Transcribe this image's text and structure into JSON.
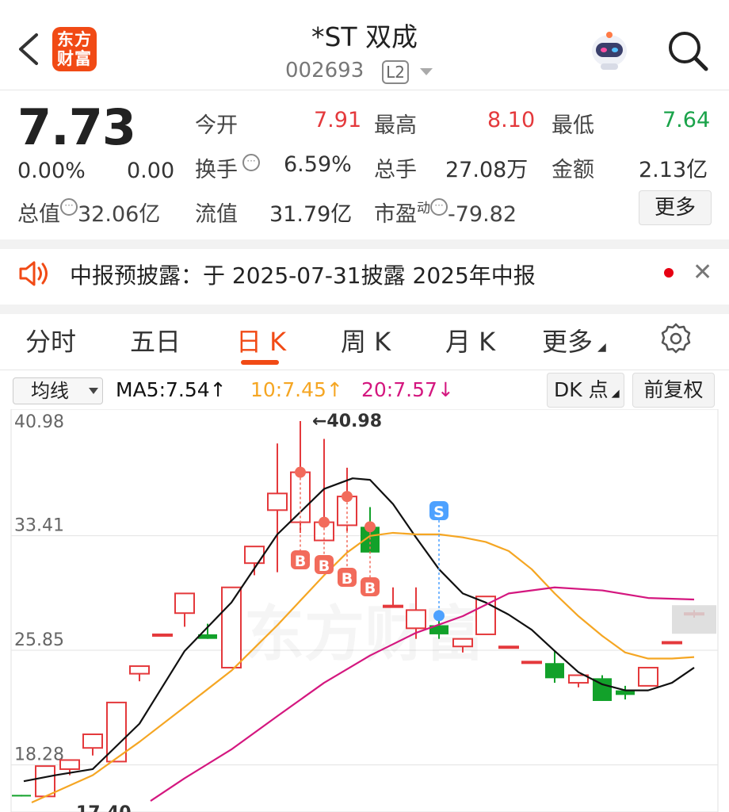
{
  "header": {
    "logo_text_line1": "东方",
    "logo_text_line2": "财富",
    "stock_name": "*ST 双成",
    "stock_code": "002693",
    "level_badge": "L2",
    "icons": [
      "back-chevron-icon",
      "robot-avatar-icon",
      "search-icon"
    ]
  },
  "quote": {
    "price": "7.73",
    "change_pct": "0.00%",
    "change": "0.00",
    "open_label": "今开",
    "open": "7.91",
    "high_label": "最高",
    "high": "8.10",
    "low_label": "最低",
    "low": "7.64",
    "turnover_label": "换手",
    "turnover": "6.59%",
    "volume_label": "总手",
    "volume": "27.08万",
    "amount_label": "金额",
    "amount": "2.13亿",
    "mktcap_label": "总值",
    "mktcap": "32.06亿",
    "float_label": "流值",
    "float_cap": "31.79亿",
    "pe_label": "市盈",
    "pe_sup": "动",
    "pe": "-79.82",
    "more_label": "更多"
  },
  "notice": {
    "text": "中报预披露：于 2025-07-31披露 2025年中报",
    "icons": [
      "speaker-icon",
      "close-icon"
    ]
  },
  "tabs": [
    {
      "label": "分时",
      "active": false
    },
    {
      "label": "五日",
      "active": false
    },
    {
      "label": "日 K",
      "active": true
    },
    {
      "label": "周 K",
      "active": false
    },
    {
      "label": "月 K",
      "active": false
    },
    {
      "label": "更多",
      "active": false
    }
  ],
  "chart_controls": {
    "indicator_select": "均线",
    "ma5": "MA5:7.54↑",
    "ma10": "10:7.45↑",
    "ma20": "20:7.57↓",
    "dk_button": "DK 点",
    "adjust_button": "前复权",
    "colors": {
      "ma5": "#111111",
      "ma10": "#f5a623",
      "ma20": "#d4177f"
    }
  },
  "chart_data": {
    "type": "candlestick",
    "y_axis_ticks": [
      "40.98",
      "33.41",
      "25.85",
      "18.28"
    ],
    "ylim": [
      16.0,
      42.0
    ],
    "high_marker": "←40.98",
    "low_label_partial": "17.40",
    "watermark": "东方财富",
    "colors": {
      "up": "#e4393c",
      "down": "#12a12a",
      "buy_marker": "#f26b5b",
      "sell_marker": "#4da1ff"
    },
    "candles": [
      {
        "x": 27,
        "o": 16.3,
        "c": 16.2,
        "h": 16.3,
        "l": 16.2
      },
      {
        "x": 57,
        "o": 16.2,
        "c": 18.2,
        "h": 18.2,
        "l": 16.2
      },
      {
        "x": 88,
        "o": 18.0,
        "c": 18.6,
        "h": 18.6,
        "l": 17.6
      },
      {
        "x": 117,
        "o": 19.4,
        "c": 20.3,
        "h": 20.3,
        "l": 18.9
      },
      {
        "x": 147,
        "o": 18.5,
        "c": 22.4,
        "h": 22.4,
        "l": 18.5
      },
      {
        "x": 176,
        "o": 24.3,
        "c": 24.8,
        "h": 24.8,
        "l": 23.8
      },
      {
        "x": 205,
        "o": 26.9,
        "c": 26.9,
        "h": 26.9,
        "l": 26.9
      },
      {
        "x": 233,
        "o": 28.3,
        "c": 29.6,
        "h": 29.6,
        "l": 27.4
      },
      {
        "x": 262,
        "o": 26.9,
        "c": 26.6,
        "h": 27.6,
        "l": 26.6
      },
      {
        "x": 292,
        "o": 24.7,
        "c": 30.0,
        "h": 30.0,
        "l": 24.7
      },
      {
        "x": 321,
        "o": 31.6,
        "c": 32.7,
        "h": 32.7,
        "l": 30.8
      },
      {
        "x": 350,
        "o": 35.1,
        "c": 36.2,
        "h": 39.5,
        "l": 31.0
      },
      {
        "x": 379,
        "o": 34.3,
        "c": 37.6,
        "h": 40.98,
        "l": 33.6
      },
      {
        "x": 409,
        "o": 33.1,
        "c": 34.3,
        "h": 39.8,
        "l": 33.1
      },
      {
        "x": 438,
        "o": 34.1,
        "c": 36.0,
        "h": 37.9,
        "l": 33.7
      },
      {
        "x": 467,
        "o": 34.0,
        "c": 32.3,
        "h": 35.3,
        "l": 32.3
      },
      {
        "x": 496,
        "o": 28.8,
        "c": 28.8,
        "h": 30.0,
        "l": 28.8
      },
      {
        "x": 525,
        "o": 27.3,
        "c": 28.5,
        "h": 30.0,
        "l": 26.6
      },
      {
        "x": 554,
        "o": 27.5,
        "c": 26.9,
        "h": 28.5,
        "l": 26.6
      },
      {
        "x": 584,
        "o": 26.1,
        "c": 26.6,
        "h": 26.6,
        "l": 25.7
      },
      {
        "x": 613,
        "o": 26.9,
        "c": 29.4,
        "h": 29.4,
        "l": 26.9
      },
      {
        "x": 642,
        "o": 26.1,
        "c": 26.1,
        "h": 26.1,
        "l": 26.1
      },
      {
        "x": 671,
        "o": 25.1,
        "c": 25.1,
        "h": 25.1,
        "l": 25.1
      },
      {
        "x": 700,
        "o": 25.0,
        "c": 24.0,
        "h": 25.8,
        "l": 23.7
      },
      {
        "x": 730,
        "o": 23.7,
        "c": 24.2,
        "h": 24.2,
        "l": 23.4
      },
      {
        "x": 760,
        "o": 24.0,
        "c": 22.5,
        "h": 24.2,
        "l": 22.5
      },
      {
        "x": 789,
        "o": 23.2,
        "c": 22.9,
        "h": 23.5,
        "l": 22.6
      },
      {
        "x": 818,
        "o": 23.5,
        "c": 24.7,
        "h": 24.7,
        "l": 23.5
      },
      {
        "x": 848,
        "o": 26.4,
        "c": 26.4,
        "h": 26.4,
        "l": 26.4
      },
      {
        "x": 876,
        "o": 28.3,
        "c": 28.3,
        "h": 28.5,
        "l": 28.0
      }
    ],
    "series": [
      {
        "name": "MA5",
        "points": [
          [
            30,
            17.2
          ],
          [
            70,
            17.6
          ],
          [
            117,
            18.0
          ],
          [
            176,
            21.0
          ],
          [
            233,
            25.8
          ],
          [
            292,
            29.0
          ],
          [
            350,
            33.5
          ],
          [
            409,
            36.5
          ],
          [
            445,
            37.2
          ],
          [
            467,
            37.1
          ],
          [
            496,
            35.5
          ],
          [
            525,
            33.3
          ],
          [
            554,
            31.2
          ],
          [
            584,
            29.6
          ],
          [
            613,
            29.0
          ],
          [
            642,
            28.2
          ],
          [
            671,
            27.2
          ],
          [
            700,
            25.8
          ],
          [
            730,
            24.4
          ],
          [
            760,
            23.6
          ],
          [
            789,
            23.2
          ],
          [
            818,
            23.2
          ],
          [
            848,
            23.7
          ],
          [
            876,
            24.7
          ]
        ]
      },
      {
        "name": "10",
        "points": [
          [
            40,
            15.8
          ],
          [
            117,
            17.6
          ],
          [
            176,
            19.8
          ],
          [
            233,
            22.1
          ],
          [
            292,
            24.5
          ],
          [
            350,
            27.5
          ],
          [
            409,
            30.8
          ],
          [
            438,
            32.3
          ],
          [
            467,
            33.4
          ],
          [
            496,
            33.6
          ],
          [
            525,
            33.5
          ],
          [
            554,
            33.5
          ],
          [
            584,
            33.3
          ],
          [
            613,
            33.0
          ],
          [
            642,
            32.4
          ],
          [
            671,
            31.2
          ],
          [
            700,
            29.6
          ],
          [
            730,
            28.1
          ],
          [
            760,
            26.8
          ],
          [
            789,
            25.7
          ],
          [
            818,
            25.3
          ],
          [
            848,
            25.3
          ],
          [
            876,
            25.4
          ]
        ]
      },
      {
        "name": "20",
        "points": [
          [
            190,
            15.9
          ],
          [
            233,
            17.4
          ],
          [
            292,
            19.3
          ],
          [
            350,
            21.5
          ],
          [
            409,
            23.7
          ],
          [
            467,
            25.5
          ],
          [
            525,
            27.0
          ],
          [
            584,
            28.1
          ],
          [
            642,
            29.6
          ],
          [
            700,
            30.0
          ],
          [
            760,
            29.8
          ],
          [
            818,
            29.3
          ],
          [
            876,
            29.2
          ]
        ]
      }
    ],
    "buy_markers": [
      {
        "x": 379,
        "label": "B"
      },
      {
        "x": 409,
        "label": "B"
      },
      {
        "x": 438,
        "label": "B"
      },
      {
        "x": 467,
        "label": "B"
      }
    ],
    "sell_markers": [
      {
        "x": 554,
        "label": "S"
      }
    ]
  }
}
